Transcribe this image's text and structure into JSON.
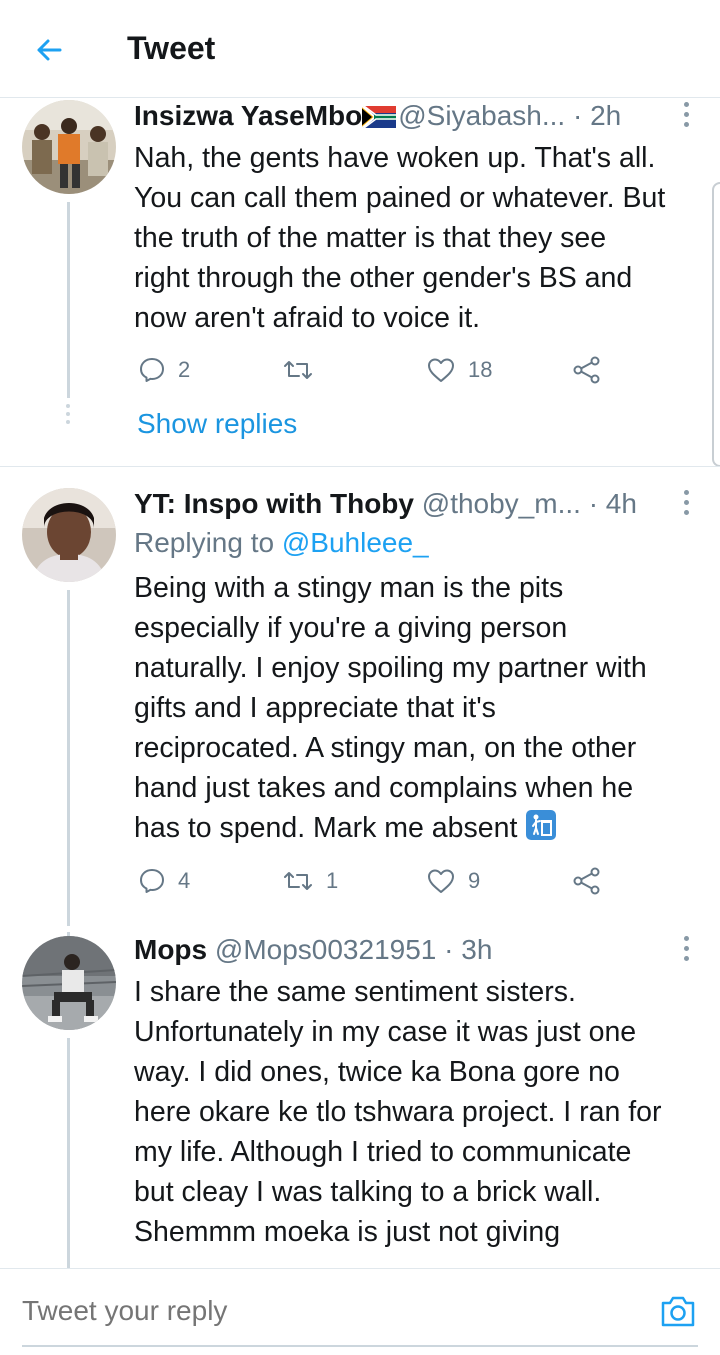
{
  "header": {
    "title": "Tweet"
  },
  "tweets": [
    {
      "name": "Insizwa YaseMbo",
      "handle": "@Siyabash...",
      "time": "· 2h",
      "reply_to_prefix": "",
      "reply_to_user": "",
      "lines": [
        "Nah, the gents have woken up. That's all.",
        "You can call them pained or whatever. But",
        "the truth of the matter is that they see",
        "right through the other gender's BS and",
        "now aren't afraid to voice it."
      ],
      "replies": "2",
      "retweets": "",
      "likes": "18",
      "show_replies": "Show replies"
    },
    {
      "name": "YT: Inspo with Thoby",
      "handle": "@thoby_m...",
      "time": "· 4h",
      "reply_to_prefix": "Replying to",
      "reply_to_user": "@Buhleee_",
      "lines": [
        "Being with a stingy man is the pits",
        "especially if you're a giving person",
        "naturally. I enjoy spoiling my partner with",
        "gifts and I appreciate that it's",
        "reciprocated. A stingy man, on the other",
        "hand just takes and complains when he",
        "has to spend. Mark me absent"
      ],
      "replies": "4",
      "retweets": "1",
      "likes": "9"
    },
    {
      "name": "Mops",
      "handle": "@Mops00321951",
      "time": "· 3h",
      "lines": [
        "I share the same sentiment sisters.",
        "Unfortunately in my case it was just one",
        "way. I did ones, twice ka Bona gore no",
        "here okare ke tlo tshwara project. I ran for",
        "my life. Although I tried to communicate",
        "but cleay I was talking to a brick wall.",
        "Shemmm moeka is just not giving"
      ]
    }
  ],
  "reply_bar": {
    "placeholder": "Tweet your reply"
  },
  "colors": {
    "accent": "#1da1f2",
    "link": "#1b95e0",
    "muted": "#657786",
    "text": "#14171a"
  },
  "icons": [
    "back-arrow-icon",
    "more-vertical-icon",
    "reply-icon",
    "retweet-icon",
    "like-icon",
    "share-icon",
    "camera-icon",
    "south-africa-flag-icon",
    "litter-bin-emoji-icon"
  ]
}
